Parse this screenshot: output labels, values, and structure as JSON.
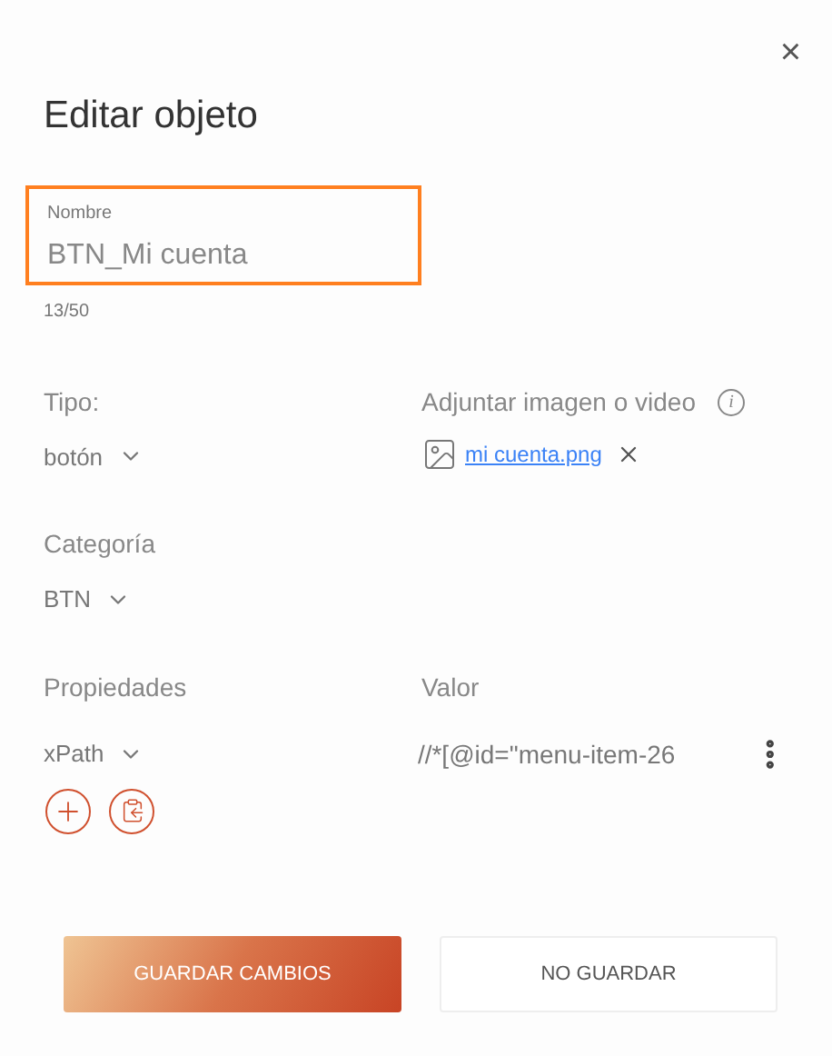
{
  "dialog": {
    "title": "Editar objeto",
    "close": "×"
  },
  "name_field": {
    "label": "Nombre",
    "value": "BTN_Mi cuenta",
    "counter": "13/50",
    "focused": true
  },
  "tipo": {
    "label": "Tipo:",
    "value": "botón"
  },
  "attachment": {
    "label": "Adjuntar imagen o video",
    "info": "i",
    "file": "mi cuenta.png"
  },
  "categoria": {
    "label": "Categoría",
    "value": "BTN"
  },
  "properties": {
    "columns": [
      "Propiedades",
      "Valor"
    ],
    "rows": [
      {
        "property": "xPath",
        "value": "//*[@id=\"menu-item-26"
      }
    ]
  },
  "buttons": [
    {
      "label": "GUARDAR CAMBIOS",
      "kind": "primary"
    },
    {
      "label": "NO GUARDAR",
      "kind": "secondary"
    }
  ]
}
